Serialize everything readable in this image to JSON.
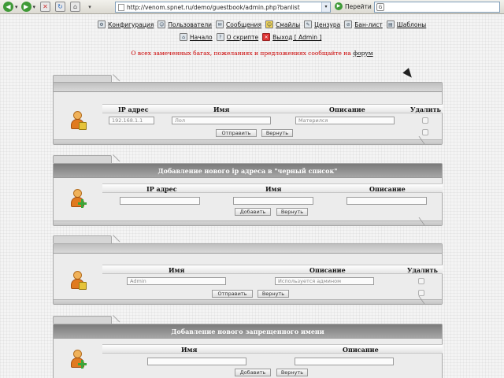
{
  "browser": {
    "url": "http://venom.spnet.ru/demo/guestbook/admin.php?banlist",
    "go_label": "Перейти",
    "search_value": ""
  },
  "nav": {
    "row1": [
      {
        "label": "Конфигурация",
        "icon": "config-icon"
      },
      {
        "label": "Пользователи",
        "icon": "users-icon"
      },
      {
        "label": "Сообщения",
        "icon": "messages-icon"
      },
      {
        "label": "Смайлы",
        "icon": "smileys-icon"
      },
      {
        "label": "Цензура",
        "icon": "censorship-icon"
      },
      {
        "label": "Бан-лист",
        "icon": "banlist-icon"
      },
      {
        "label": "Шаблоны",
        "icon": "templates-icon"
      }
    ],
    "row2": [
      {
        "label": "Начало",
        "icon": "home-icon"
      },
      {
        "label": "О скрипте",
        "icon": "about-icon"
      },
      {
        "label": "Выход [ Admin ]",
        "icon": "logout-icon"
      }
    ]
  },
  "notice": {
    "text": "О всех замеченных багах, пожеланиях и предложениях сообщайте на ",
    "link": "форум"
  },
  "ip_list": {
    "headers": {
      "ip": "IP адрес",
      "name": "Имя",
      "description": "Описание",
      "delete": "Удалить"
    },
    "row": {
      "ip": "192.168.1.1",
      "name": "Лол",
      "description": "Матерился"
    },
    "submit_label": "Отправить",
    "reset_label": "Вернуть"
  },
  "add_ip": {
    "title": "Добавление нового ip адреса в \"черный список\"",
    "headers": {
      "ip": "IP адрес",
      "name": "Имя",
      "description": "Описание"
    },
    "add_label": "Добавить",
    "reset_label": "Вернуть"
  },
  "name_list": {
    "headers": {
      "name": "Имя",
      "description": "Описание",
      "delete": "Удалить"
    },
    "row": {
      "name": "Admin",
      "description": "Используется админом"
    },
    "submit_label": "Отправить",
    "reset_label": "Вернуть"
  },
  "add_name": {
    "title": "Добавление нового запрещенного имени",
    "headers": {
      "name": "Имя",
      "description": "Описание"
    },
    "add_label": "Добавить",
    "reset_label": "Вернуть"
  }
}
